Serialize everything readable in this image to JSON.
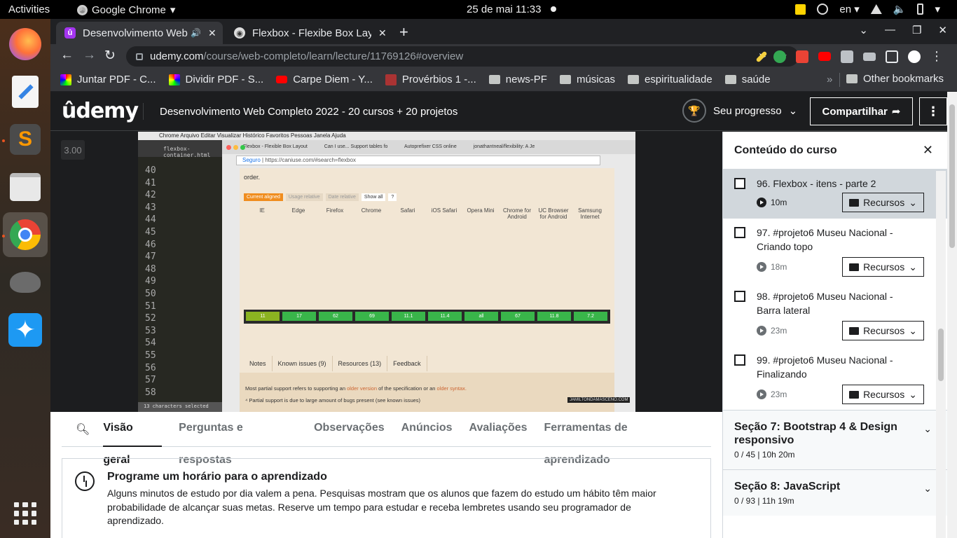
{
  "system": {
    "activities": "Activities",
    "app_name": "Google Chrome",
    "datetime": "25 de mai  11:33",
    "language": "en"
  },
  "browser": {
    "tabs": [
      {
        "title": "Desenvolvimento Web",
        "favicon": "udemy"
      },
      {
        "title": "Flexbox - Flexibe Box Layo",
        "favicon": "globe"
      }
    ],
    "url_host": "udemy.com",
    "url_path": "/course/web-completo/learn/lecture/11769126#overview",
    "bookmarks": [
      {
        "label": "Juntar PDF - C...",
        "icon": "pdf-icon"
      },
      {
        "label": "Dividir PDF - S...",
        "icon": "pdf-icon"
      },
      {
        "label": "Carpe Diem - Y...",
        "icon": "youtube-icon"
      },
      {
        "label": "Provérbios 1 -...",
        "icon": "bible-icon"
      },
      {
        "label": "news-PF",
        "icon": "folder-icon"
      },
      {
        "label": "músicas",
        "icon": "folder-icon"
      },
      {
        "label": "espiritualidade",
        "icon": "folder-icon"
      },
      {
        "label": "saúde",
        "icon": "folder-icon"
      }
    ],
    "other_bookmarks": "Other bookmarks"
  },
  "header": {
    "logo": "ûdemy",
    "course_title": "Desenvolvimento Web Completo 2022 - 20 cursos + 20 projetos",
    "progress_label": "Seu progresso",
    "share_label": "Compartilhar"
  },
  "video": {
    "speed": "3.00",
    "editor_lines": [
      "40",
      "41",
      "42",
      "43",
      "44",
      "45",
      "46",
      "47",
      "48",
      "49",
      "50",
      "51",
      "52",
      "53",
      "54",
      "55",
      "56",
      "57",
      "58"
    ],
    "editor_file": "flexbox-container.html",
    "editor_status": "13 characters selected",
    "inner_tabs": [
      "Flexbox - Flexible Box Layout",
      "Can I use... Support tables fo",
      "Autoprefixer CSS online",
      "jonathantneal/flexibility: A Je"
    ],
    "inner_url_secure": "Seguro",
    "inner_url": "https://caniuse.com/#search=flexbox",
    "ciu_intro": "order.",
    "ciu_buttons": [
      "Current aligned",
      "Usage relative",
      "Date relative",
      "Show all",
      "?"
    ],
    "ciu_browsers": [
      "IE",
      "Edge",
      "Firefox",
      "Chrome",
      "Safari",
      "iOS Safari",
      "Opera Mini",
      "Chrome for Android",
      "UC Browser for Android",
      "Samsung Internet"
    ],
    "ciu_current": [
      "11",
      "17",
      "62",
      "69",
      "11.1",
      "11.4",
      "all",
      "67",
      "11.8",
      "7.2"
    ],
    "ciu_tabs": [
      "Notes",
      "Known issues (9)",
      "Resources (13)",
      "Feedback"
    ],
    "ciu_note1_a": "Most partial support refers to supporting an ",
    "ciu_note1_b": "older version",
    "ciu_note1_c": " of the specification or an ",
    "ciu_note1_d": "older syntax.",
    "ciu_note2": "Partial support is due to large amount of bugs present (see known issues)",
    "watermark": "JAMILTONDAMASCENO.COM"
  },
  "course_tabs": [
    "Visão geral",
    "Perguntas e respostas",
    "Observações",
    "Anúncios",
    "Avaliações",
    "Ferramentas de aprendizado"
  ],
  "reminder": {
    "title": "Programe um horário para o aprendizado",
    "body": "Alguns minutos de estudo por dia valem a pena. Pesquisas mostram que os alunos que fazem do estudo um hábito têm maior probabilidade de alcançar suas metas. Reserve um tempo para estudar e receba lembretes usando seu programador de aprendizado."
  },
  "sidebar": {
    "title": "Conteúdo do curso",
    "lectures": [
      {
        "title": "96. Flexbox - itens - parte 2",
        "duration": "10m",
        "resources": "Recursos"
      },
      {
        "title": "97. #projeto6 Museu Nacional - Criando topo",
        "duration": "18m",
        "resources": "Recursos"
      },
      {
        "title": "98. #projeto6 Museu Nacional - Barra lateral",
        "duration": "23m",
        "resources": "Recursos"
      },
      {
        "title": "99. #projeto6 Museu Nacional - Finalizando",
        "duration": "23m",
        "resources": "Recursos"
      }
    ],
    "sections": [
      {
        "title": "Seção 7: Bootstrap 4 & Design responsivo",
        "info": "0 / 45 | 10h 20m"
      },
      {
        "title": "Seção 8: JavaScript",
        "info": "0 / 93 | 11h 19m"
      }
    ]
  },
  "colors": {
    "udemy_purple": "#a435f0",
    "caniuse_green": "#39b54a",
    "caniuse_orange": "#f08d1e"
  }
}
